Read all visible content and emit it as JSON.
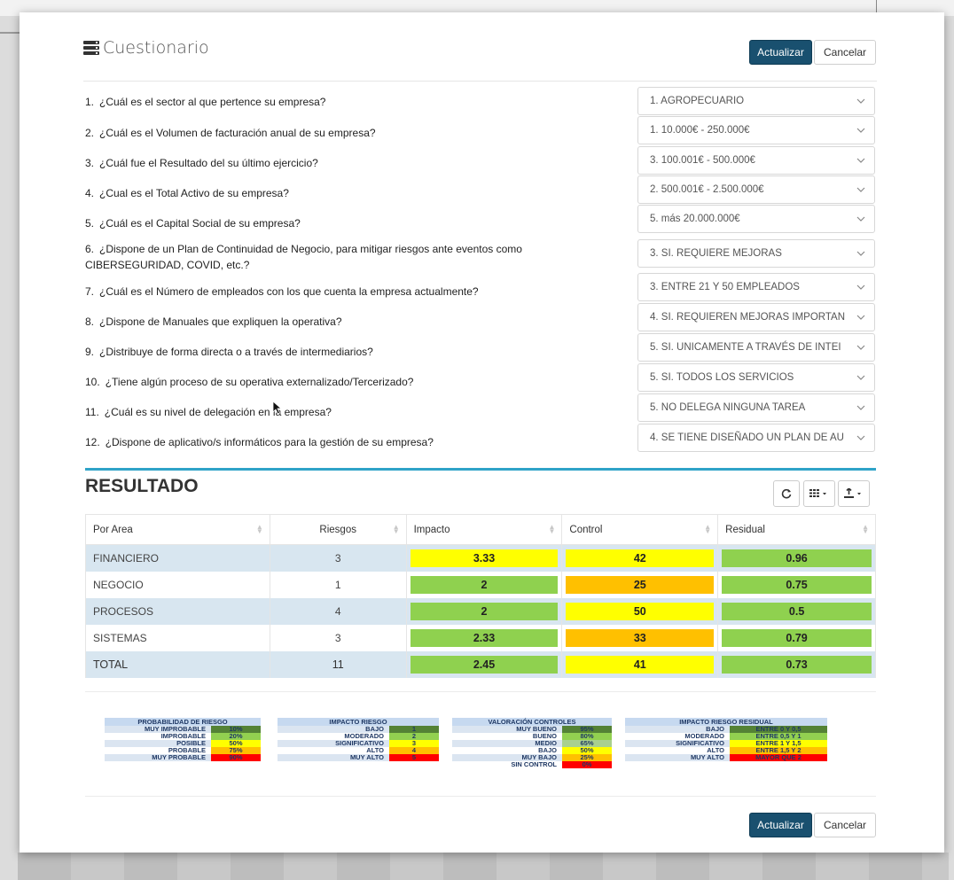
{
  "modal": {
    "title": "Cuestionario",
    "update_label": "Actualizar",
    "cancel_label": "Cancelar"
  },
  "questions": [
    {
      "num": "1.",
      "text": "¿Cuál es el sector al que pertence su empresa?",
      "answer": "1. AGROPECUARIO"
    },
    {
      "num": "2.",
      "text": "¿Cuál es el Volumen de facturación anual de su empresa?",
      "answer": "1.  10.000€ - 250.000€"
    },
    {
      "num": "3.",
      "text": "¿Cuál fue el Resultado del su último ejercicio?",
      "answer": "3. 100.001€ - 500.000€"
    },
    {
      "num": "4.",
      "text": "¿Cual es el Total Activo de su empresa?",
      "answer": "2. 500.001€ - 2.500.000€"
    },
    {
      "num": "5.",
      "text": "¿Cuál es el Capital Social de su empresa?",
      "answer": "5. más 20.000.000€"
    },
    {
      "num": "6.",
      "text": "¿Dispone de un Plan de Continuidad de Negocio, para mitigar riesgos ante eventos como",
      "text2": "CIBERSEGURIDAD, COVID, etc.?",
      "answer": "3. SI. REQUIERE MEJORAS"
    },
    {
      "num": "7.",
      "text": "¿Cuál es el Número de empleados con los que cuenta la empresa actualmente?",
      "answer": "3. ENTRE 21 Y 50 EMPLEADOS"
    },
    {
      "num": "8.",
      "text": "¿Dispone de Manuales que expliquen la operativa?",
      "answer": "4. SI. REQUIEREN MEJORAS IMPORTAN"
    },
    {
      "num": "9.",
      "text": "¿Distribuye de forma directa o a través de intermediarios?",
      "answer": "5. SI. UNICAMENTE A TRAVÉS DE INTEI"
    },
    {
      "num": "10.",
      "text": "¿Tiene algún proceso de su operativa externalizado/Tercerizado?",
      "answer": "5. SI. TODOS LOS SERVICIOS"
    },
    {
      "num": "11.",
      "text": "¿Cuál es su nivel de delegación en la empresa?",
      "answer": "5. NO DELEGA NINGUNA TAREA"
    },
    {
      "num": "12.",
      "text": "¿Dispone de aplicativo/s informáticos para la gestión de su empresa?",
      "answer": "4. SE TIENE DISEÑADO UN PLAN DE AU"
    }
  ],
  "result": {
    "title": "RESULTADO",
    "headers": [
      "Por Area",
      "Riesgos",
      "Impacto",
      "Control",
      "Residual"
    ],
    "rows": [
      {
        "area": "FINANCIERO",
        "riesgos": "3",
        "impacto": "3.33",
        "impacto_color": "yellow",
        "control": "42",
        "control_color": "yellow",
        "residual": "0.96",
        "residual_color": "green"
      },
      {
        "area": "NEGOCIO",
        "riesgos": "1",
        "impacto": "2",
        "impacto_color": "green",
        "control": "25",
        "control_color": "orange",
        "residual": "0.75",
        "residual_color": "green"
      },
      {
        "area": "PROCESOS",
        "riesgos": "4",
        "impacto": "2",
        "impacto_color": "green",
        "control": "50",
        "control_color": "yellow",
        "residual": "0.5",
        "residual_color": "green"
      },
      {
        "area": "SISTEMAS",
        "riesgos": "3",
        "impacto": "2.33",
        "impacto_color": "green",
        "control": "33",
        "control_color": "orange",
        "residual": "0.79",
        "residual_color": "green"
      }
    ],
    "total": {
      "area": "TOTAL",
      "riesgos": "11",
      "impacto": "2.45",
      "impacto_color": "green",
      "control": "41",
      "control_color": "yellow",
      "residual": "0.73",
      "residual_color": "green"
    },
    "toolbar_icons": [
      "refresh-icon",
      "columns-icon",
      "export-icon"
    ]
  },
  "legends": {
    "probabilidad": {
      "title": "PROBABILIDAD DE RIESGO",
      "rows": [
        [
          "MUY IMPROBABLE",
          "10%"
        ],
        [
          "IMPROBABLE",
          "20%"
        ],
        [
          "POSIBLE",
          "50%"
        ],
        [
          "PROBABLE",
          "75%"
        ],
        [
          "MUY PROBABLE",
          "90%"
        ]
      ]
    },
    "impacto": {
      "title": "IMPACTO RIESGO",
      "rows": [
        [
          "BAJO",
          "1"
        ],
        [
          "MODERADO",
          "2"
        ],
        [
          "SIGNIFICATIVO",
          "3"
        ],
        [
          "ALTO",
          "4"
        ],
        [
          "MUY ALTO",
          "5"
        ]
      ]
    },
    "controles": {
      "title": "VALORACIÓN CONTROLES",
      "rows": [
        [
          "MUY BUENO",
          "95%"
        ],
        [
          "BUENO",
          "80%"
        ],
        [
          "MEDIO",
          "65%"
        ],
        [
          "BAJO",
          "50%"
        ],
        [
          "MUY BAJO",
          "25%"
        ],
        [
          "SIN CONTROL",
          "0%"
        ]
      ]
    },
    "residual": {
      "title": "IMPACTO RIESGO RESIDUAL",
      "rows": [
        [
          "BAJO",
          "ENTRE 0 Y 0,5"
        ],
        [
          "MODERADO",
          "ENTRE 0,5 Y 1"
        ],
        [
          "SIGNIFICATIVO",
          "ENTRE 1 Y 1,5"
        ],
        [
          "ALTO",
          "ENTRE 1,5 Y 2"
        ],
        [
          "MUY ALTO",
          "MAYOR QUE 2"
        ]
      ]
    }
  },
  "colors": {
    "primary": "#19506f",
    "accent_divider": "#2fa3c8",
    "green": "#8fd14f",
    "yellow": "#ffff00",
    "orange": "#ffc000"
  }
}
